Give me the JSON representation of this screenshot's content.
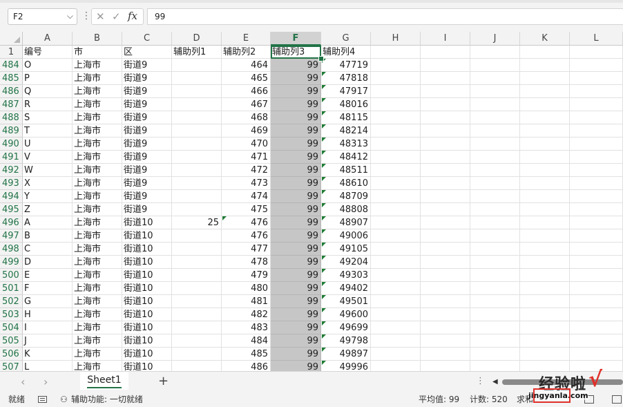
{
  "formula_bar": {
    "name_box": "F2",
    "formula_value": "99",
    "fx_label": "fx"
  },
  "columns": [
    "A",
    "B",
    "C",
    "D",
    "E",
    "F",
    "G",
    "H",
    "I",
    "J",
    "K",
    "L"
  ],
  "selected_column": "F",
  "header_row": {
    "row_number": "1",
    "cells": [
      "编号",
      "市",
      "区",
      "辅助列1",
      "辅助列2",
      "辅助列3",
      "辅助列4",
      "",
      "",
      "",
      "",
      ""
    ]
  },
  "rows": [
    {
      "n": "484",
      "a": "O",
      "b": "上海市",
      "c": "街道9",
      "d": "",
      "e": "464",
      "f": "99",
      "g": "47719"
    },
    {
      "n": "485",
      "a": "P",
      "b": "上海市",
      "c": "街道9",
      "d": "",
      "e": "465",
      "f": "99",
      "g": "47818"
    },
    {
      "n": "486",
      "a": "Q",
      "b": "上海市",
      "c": "街道9",
      "d": "",
      "e": "466",
      "f": "99",
      "g": "47917"
    },
    {
      "n": "487",
      "a": "R",
      "b": "上海市",
      "c": "街道9",
      "d": "",
      "e": "467",
      "f": "99",
      "g": "48016"
    },
    {
      "n": "488",
      "a": "S",
      "b": "上海市",
      "c": "街道9",
      "d": "",
      "e": "468",
      "f": "99",
      "g": "48115"
    },
    {
      "n": "489",
      "a": "T",
      "b": "上海市",
      "c": "街道9",
      "d": "",
      "e": "469",
      "f": "99",
      "g": "48214"
    },
    {
      "n": "490",
      "a": "U",
      "b": "上海市",
      "c": "街道9",
      "d": "",
      "e": "470",
      "f": "99",
      "g": "48313"
    },
    {
      "n": "491",
      "a": "V",
      "b": "上海市",
      "c": "街道9",
      "d": "",
      "e": "471",
      "f": "99",
      "g": "48412"
    },
    {
      "n": "492",
      "a": "W",
      "b": "上海市",
      "c": "街道9",
      "d": "",
      "e": "472",
      "f": "99",
      "g": "48511"
    },
    {
      "n": "493",
      "a": "X",
      "b": "上海市",
      "c": "街道9",
      "d": "",
      "e": "473",
      "f": "99",
      "g": "48610"
    },
    {
      "n": "494",
      "a": "Y",
      "b": "上海市",
      "c": "街道9",
      "d": "",
      "e": "474",
      "f": "99",
      "g": "48709"
    },
    {
      "n": "495",
      "a": "Z",
      "b": "上海市",
      "c": "街道9",
      "d": "",
      "e": "475",
      "f": "99",
      "g": "48808"
    },
    {
      "n": "496",
      "a": "A",
      "b": "上海市",
      "c": "街道10",
      "d": "25",
      "e": "476",
      "f": "99",
      "g": "48907"
    },
    {
      "n": "497",
      "a": "B",
      "b": "上海市",
      "c": "街道10",
      "d": "",
      "e": "476",
      "f": "99",
      "g": "49006"
    },
    {
      "n": "498",
      "a": "C",
      "b": "上海市",
      "c": "街道10",
      "d": "",
      "e": "477",
      "f": "99",
      "g": "49105"
    },
    {
      "n": "499",
      "a": "D",
      "b": "上海市",
      "c": "街道10",
      "d": "",
      "e": "478",
      "f": "99",
      "g": "49204"
    },
    {
      "n": "500",
      "a": "E",
      "b": "上海市",
      "c": "街道10",
      "d": "",
      "e": "479",
      "f": "99",
      "g": "49303"
    },
    {
      "n": "501",
      "a": "F",
      "b": "上海市",
      "c": "街道10",
      "d": "",
      "e": "480",
      "f": "99",
      "g": "49402"
    },
    {
      "n": "502",
      "a": "G",
      "b": "上海市",
      "c": "街道10",
      "d": "",
      "e": "481",
      "f": "99",
      "g": "49501"
    },
    {
      "n": "503",
      "a": "H",
      "b": "上海市",
      "c": "街道10",
      "d": "",
      "e": "482",
      "f": "99",
      "g": "49600"
    },
    {
      "n": "504",
      "a": "I",
      "b": "上海市",
      "c": "街道10",
      "d": "",
      "e": "483",
      "f": "99",
      "g": "49699"
    },
    {
      "n": "505",
      "a": "J",
      "b": "上海市",
      "c": "街道10",
      "d": "",
      "e": "484",
      "f": "99",
      "g": "49798"
    },
    {
      "n": "506",
      "a": "K",
      "b": "上海市",
      "c": "街道10",
      "d": "",
      "e": "485",
      "f": "99",
      "g": "49897"
    },
    {
      "n": "507",
      "a": "L",
      "b": "上海市",
      "c": "街道10",
      "d": "",
      "e": "486",
      "f": "99",
      "g": "49996"
    }
  ],
  "sheet_tabs": [
    "Sheet1"
  ],
  "status_bar": {
    "ready": "就绪",
    "accessibility": "辅助功能: 一切就绪",
    "average": "平均值: 99",
    "count": "计数: 520",
    "sum_partial": "求和"
  },
  "watermark": {
    "title": "经验啦",
    "url": "jingyanla.com"
  },
  "colors": {
    "accent_green": "#217346",
    "selection_fill": "#c6c6c6",
    "header_bg": "#f3f3f3"
  }
}
